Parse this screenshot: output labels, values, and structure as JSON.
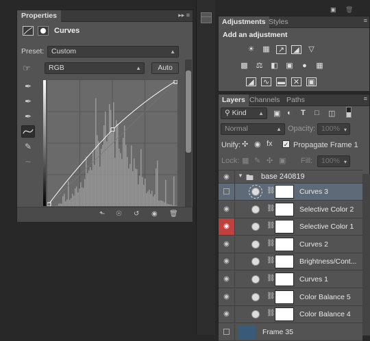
{
  "properties": {
    "tab_label": "Properties",
    "header_controls": "▸▸  ≡",
    "title": "Curves",
    "preset_label": "Preset:",
    "preset_value": "Custom",
    "channel_value": "RGB",
    "auto_label": "Auto"
  },
  "adjustments": {
    "tabs": [
      "Adjustments",
      "Styles"
    ],
    "heading": "Add an adjustment",
    "icons_row1": [
      "brightness-icon",
      "levels-icon",
      "curves-icon",
      "exposure-icon",
      "vibrance-icon"
    ],
    "icons_row2": [
      "hue-sat-icon",
      "color-balance-icon",
      "black-white-icon",
      "photo-filter-icon",
      "channel-mixer-icon",
      "color-lookup-icon"
    ],
    "icons_row3": [
      "invert-icon",
      "posterize-icon",
      "threshold-icon",
      "gradient-map-icon",
      "selective-color-icon"
    ]
  },
  "layers": {
    "tabs": [
      "Layers",
      "Channels",
      "Paths"
    ],
    "kind_label": "Kind",
    "blend_mode": "Normal",
    "opacity_label": "Opacity:",
    "opacity_value": "100%",
    "unify_label": "Unify:",
    "propagate_label": "Propagate Frame 1",
    "lock_label": "Lock:",
    "fill_label": "Fill:",
    "fill_value": "100%",
    "group_name": "base 240819",
    "rows": [
      {
        "name": "Curves 3"
      },
      {
        "name": "Selective Color 2"
      },
      {
        "name": "Selective Color 1"
      },
      {
        "name": "Curves 2"
      },
      {
        "name": "Brightness/Cont..."
      },
      {
        "name": "Curves 1"
      },
      {
        "name": "Color Balance 5"
      },
      {
        "name": "Color Balance 4"
      }
    ],
    "bottom_layer": "Frame 35"
  },
  "colors": {
    "panel": "#535353",
    "dark": "#3a3a3a",
    "selected_row": "#5e6a78",
    "eye_red": "#c0403e"
  },
  "curve": {
    "points": [
      [
        0,
        0
      ],
      [
        128,
        155
      ],
      [
        255,
        255
      ]
    ]
  }
}
